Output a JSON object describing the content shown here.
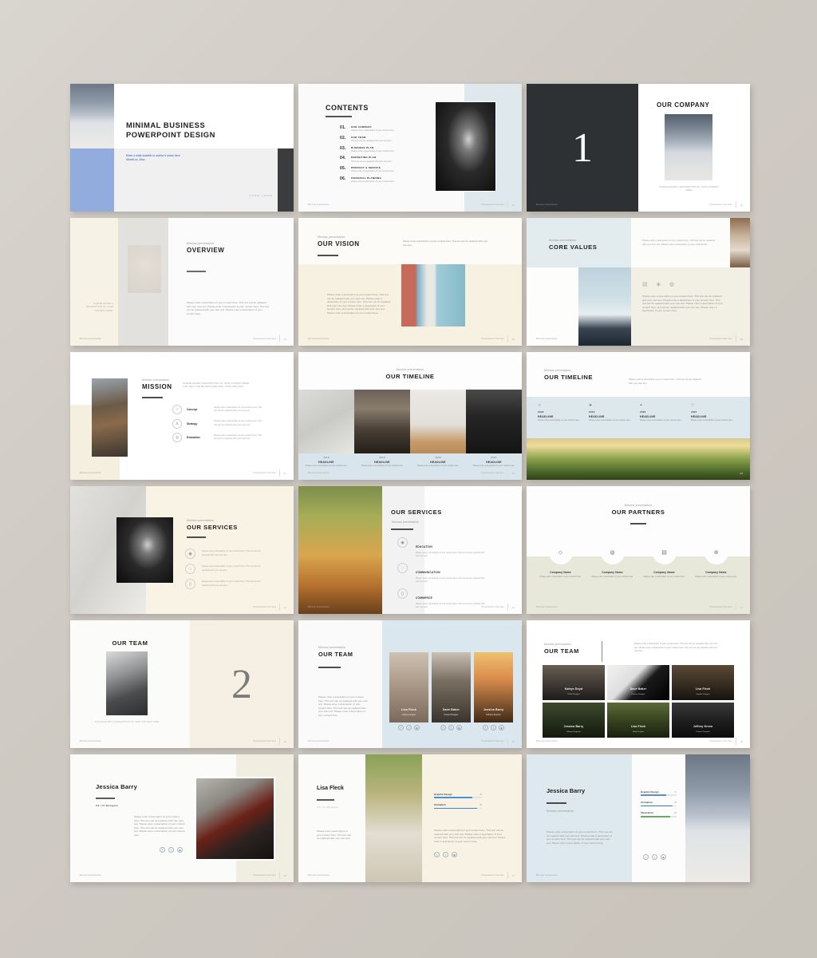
{
  "deck": {
    "footer_left": "Minimal presentation",
    "footer_right": "Presentation title here",
    "eyebrow": "Minimal presentation",
    "lorem_short": "Please enter a description of your content here. This text can be replaced with your own text.",
    "lorem_med": "Please enter a description of your content here. This text can be replaced with your own text. Please enter a description of your content here. This text can be replaced with your own text.",
    "lorem_long": "Please enter a description of your content here. This text can be replaced with your own text. Please enter a description of your content here. This text can be replaced with your own text. Please enter a description of your content here.",
    "caption_company": "PLEASE ENTER A DESCRIPTION OF YOUR CONTENT HERE."
  },
  "slides": {
    "title": {
      "line1": "MINIMAL BUSINESS",
      "line2": "POWERPOINT DESIGN",
      "subtitle1": "Enter a slide subtitle or author's name here",
      "subtitle2": "Month xx, 20xx",
      "logo": "YOUR LOGO",
      "page": "01"
    },
    "contents": {
      "title": "CONTENTS",
      "page": "02",
      "items": [
        {
          "num": "01.",
          "label": "OUR COMPANY",
          "desc": "Please enter a description of your content here."
        },
        {
          "num": "02.",
          "label": "OUR TEAM",
          "desc": "This text can be replaced with your own text."
        },
        {
          "num": "03.",
          "label": "BUSINESS PLAN",
          "desc": "Please enter a description of your content here."
        },
        {
          "num": "04.",
          "label": "MARKETING PLAN",
          "desc": "This text can be replaced with your own text."
        },
        {
          "num": "05.",
          "label": "PRODUCT & SERVICE",
          "desc": "Please enter a description of your content here."
        },
        {
          "num": "06.",
          "label": "FINANCIAL PLANNING",
          "desc": "Please enter a description of your content here."
        }
      ]
    },
    "section_company": {
      "number": "1",
      "title": "OUR COMPANY",
      "caption": "PLEASE ENTER A DESCRIPTION OF YOUR COMPANY HERE.",
      "page": "03"
    },
    "overview": {
      "eyebrow": "Minimal presentation",
      "title": "OVERVIEW",
      "side_caption": "PLEASE ENTER A DESCRIPTION OF YOUR CONTENT HERE.",
      "body": "Please enter a description of your content here. This text can be replaced with your own text. Please enter a description of your content here. This text can be replaced with your own text. Please enter a description of your content here.",
      "page": "04"
    },
    "vision": {
      "eyebrow": "Minimal presentation",
      "title": "OUR VISION",
      "head": "Please enter a description of your content here. This text can be replaced with your own text.",
      "body": "Please enter a description of your content here. This text can be replaced with your own text. Please enter a description of your content here. This text can be replaced with your own text. Please enter a description of your content here, text can be replaced with your own text. Please enter a description of your content here.",
      "page": "05"
    },
    "core_values": {
      "eyebrow": "Minimal presentation",
      "title": "CORE VALUES",
      "head": "Please enter a description of your content here. This text can be replaced with your own text. Please enter a description of your content here.",
      "body": "Please enter a description of your content here. This text can be replaced with your own text. Please enter a description of your content here. This text can be replaced with your own text. Please enter a description of your content here, text can be replaced with your own text. Please enter a description of your content here.",
      "icons": [
        "book-icon",
        "globe-icon",
        "bulb-icon"
      ],
      "page": "06"
    },
    "mission": {
      "eyebrow": "Minimal presentation",
      "title": "MISSION",
      "head": "PLEASE ENTER A DESCRIPTION OF YOUR CONTENT HERE. THIS TEXT CAN BE REPLACED WITH YOUR OWN TEXT.",
      "rows": [
        {
          "icon": "star-icon",
          "label": "Concept",
          "desc": "Please enter a description of your content here. This text can be replaced with your own text."
        },
        {
          "icon": "thumbs-up-icon",
          "label": "Strategy",
          "desc": "Please enter a description of your content here. This text can be replaced with your own text."
        },
        {
          "icon": "target-icon",
          "label": "Evaluation",
          "desc": "Please enter a description of your content here. This text can be replaced with your own text."
        }
      ],
      "page": "07"
    },
    "timeline_a": {
      "eyebrow": "Minimal presentation",
      "title": "OUR TIMELINE",
      "columns": [
        {
          "year": "2018",
          "headline": "HEADLINE",
          "desc": "Please enter a description of your content here."
        },
        {
          "year": "2019",
          "headline": "HEADLINE",
          "desc": "Please enter a description of your content here."
        },
        {
          "year": "2020",
          "headline": "HEADLINE",
          "desc": "Please enter a description of your content here."
        },
        {
          "year": "2021",
          "headline": "HEADLINE",
          "desc": "Please enter a description of your content here."
        }
      ],
      "page": "08"
    },
    "timeline_b": {
      "eyebrow": "Minimal presentation",
      "title": "OUR TIMELINE",
      "head": "Please enter a description of your content here. This text can be replaced with your own text.",
      "columns": [
        {
          "icon": "star-icon",
          "year": "2018",
          "headline": "HEADLINE",
          "desc": "Please enter a description of your content here."
        },
        {
          "icon": "rocket-icon",
          "year": "2019",
          "headline": "HEADLINE",
          "desc": "Please enter a description of your content here."
        },
        {
          "icon": "bulb-icon",
          "year": "2020",
          "headline": "HEADLINE",
          "desc": "Please enter a description of your content here."
        },
        {
          "icon": "diamond-icon",
          "year": "2021",
          "headline": "HEADLINE",
          "desc": "Please enter a description of your content here."
        }
      ],
      "page": "09"
    },
    "services_a": {
      "eyebrow": "Minimal presentation",
      "title": "OUR SERVICES",
      "rows": [
        {
          "icon": "pin-icon",
          "desc": "Please enter a description of your content here. This text can be replaced with your own text."
        },
        {
          "icon": "chat-icon",
          "desc": "Please enter a description of your content here. This text can be replaced with your own text."
        },
        {
          "icon": "phone-icon",
          "desc": "Please enter a description of your content here. This text can be replaced with your own text."
        }
      ],
      "page": "10"
    },
    "services_b": {
      "eyebrow": "Minimal presentation",
      "title": "OUR SERVICES",
      "rows": [
        {
          "icon": "pin-icon",
          "label": "EDUCATION",
          "desc": "Please enter a description of your content here. This text can be replaced with your own text."
        },
        {
          "icon": "chat-icon",
          "label": "COMMUNICATION",
          "desc": "Please enter a description of your content here. This text can be replaced with your own text."
        },
        {
          "icon": "phone-icon",
          "label": "COMMERCE",
          "desc": "Please enter a description of your content here. This text can be replaced with your own text."
        }
      ],
      "page": "11"
    },
    "partners": {
      "eyebrow": "Minimal presentation",
      "title": "OUR PARTNERS",
      "items": [
        {
          "icon": "layers-icon",
          "name": "Company Name",
          "desc": "Please enter a description of your content here."
        },
        {
          "icon": "compass-icon",
          "name": "Company Name",
          "desc": "Please enter a description of your content here."
        },
        {
          "icon": "briefcase-icon",
          "name": "Company Name",
          "desc": "Please enter a description of your content here."
        },
        {
          "icon": "globe-icon",
          "name": "Company Name",
          "desc": "Please enter a description of your content here."
        }
      ],
      "page": "12"
    },
    "section_team": {
      "number": "2",
      "title": "OUR TEAM",
      "caption": "PLEASE ENTER A DESCRIPTION OF YOUR CONTENT HERE.",
      "page": "13"
    },
    "team_a": {
      "eyebrow": "Minimal presentation",
      "title": "OUR TEAM",
      "body": "Please enter a description of your content here. This text can be replaced with your own text. Please enter a description of your content here. This text can be replaced with your own text. Please enter a description of your content here.",
      "members": [
        {
          "name": "Lisa Fleck",
          "role": "Graphic Designer"
        },
        {
          "name": "Dave Baker",
          "role": "Product Designer"
        },
        {
          "name": "Jessica Barry",
          "role": "Software Engineer"
        }
      ],
      "social": [
        "facebook-icon",
        "twitter-icon",
        "instagram-icon"
      ],
      "page": "14"
    },
    "team_b": {
      "eyebrow": "Minimal presentation",
      "title": "OUR TEAM",
      "head": "Please enter a description of your content here. This text can be replaced with your own text. Please enter a description of your content here. This text can be replaced with your own text.",
      "members": [
        {
          "name": "Katryn Doyd",
          "role": "UX/UI Designer"
        },
        {
          "name": "Dave Baker",
          "role": "Product Designer"
        },
        {
          "name": "Lisa Fleck",
          "role": "Graphic Designer"
        },
        {
          "name": "Jessica Barry",
          "role": "Software Engineer"
        },
        {
          "name": "Lisa Fleck",
          "role": "Body Designer"
        },
        {
          "name": "Jeffrey Green",
          "role": "Product Designer"
        }
      ],
      "page": "15"
    },
    "profile_jessica": {
      "name": "Jessica Barry",
      "role": "UX / UI Designer",
      "body": "Please enter a description of your content here. This text can be replaced with your own text. Please enter a description of your content here. This text can be replaced with your own text. Please enter a description of your content here.",
      "social": [
        "facebook-icon",
        "twitter-icon",
        "instagram-icon"
      ],
      "page": "16"
    },
    "profile_lisa": {
      "name": "Lisa Fleck",
      "role": "UX / UI Designer",
      "body": "Please enter a description of your content here. This text can be replaced with your own text.",
      "body2": "Please enter a description of your content here. This text can be replaced with your own text. Please enter a description of your content here. This text can be replaced with your own text. Please enter a description of your content here.",
      "skills": [
        {
          "name": "Graphic Design",
          "value": "80",
          "color": "#4a90d9"
        },
        {
          "name": "Animation",
          "value": "90",
          "color": "#3a86d0"
        }
      ],
      "social": [
        "facebook-icon",
        "twitter-icon",
        "instagram-icon"
      ],
      "page": "17"
    },
    "profile_jessica2": {
      "name": "Jessica Barry",
      "eyebrow": "Minimal presentation",
      "body": "Please enter a description of your content here. This text can be replaced with your own text. Please enter a description of your content here. This text can be replaced with your own text. Please enter a description of your content here.",
      "skills": [
        {
          "name": "Graphic Design",
          "value": "72",
          "color": "#5b8fd4"
        },
        {
          "name": "Animation",
          "value": "88",
          "color": "#2f7fc9"
        },
        {
          "name": "Illustration",
          "value": "82",
          "color": "#6aa96a"
        }
      ],
      "social": [
        "facebook-icon",
        "twitter-icon",
        "instagram-icon"
      ],
      "page": "18"
    }
  }
}
